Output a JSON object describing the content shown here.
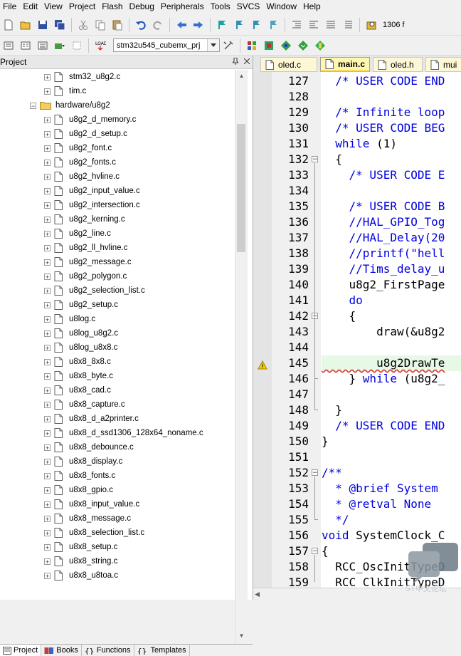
{
  "menu": [
    "File",
    "Edit",
    "View",
    "Project",
    "Flash",
    "Debug",
    "Peripherals",
    "Tools",
    "SVCS",
    "Window",
    "Help"
  ],
  "toolbar": {
    "find_text": "1306 f",
    "target": "stm32u545_cubemx_prj"
  },
  "project_panel": {
    "title": "Project",
    "pin_icon": "pin-icon",
    "close_icon": "close-icon",
    "tree": [
      {
        "label": "stm32_u8g2.c",
        "type": "file",
        "level": 2
      },
      {
        "label": "tim.c",
        "type": "file",
        "level": 2
      },
      {
        "label": "hardware/u8g2",
        "type": "folder",
        "level": 1
      },
      {
        "label": "u8g2_d_memory.c",
        "type": "file",
        "level": 2
      },
      {
        "label": "u8g2_d_setup.c",
        "type": "file",
        "level": 2
      },
      {
        "label": "u8g2_font.c",
        "type": "file",
        "level": 2
      },
      {
        "label": "u8g2_fonts.c",
        "type": "file",
        "level": 2
      },
      {
        "label": "u8g2_hvline.c",
        "type": "file",
        "level": 2
      },
      {
        "label": "u8g2_input_value.c",
        "type": "file",
        "level": 2
      },
      {
        "label": "u8g2_intersection.c",
        "type": "file",
        "level": 2
      },
      {
        "label": "u8g2_kerning.c",
        "type": "file",
        "level": 2
      },
      {
        "label": "u8g2_line.c",
        "type": "file",
        "level": 2
      },
      {
        "label": "u8g2_ll_hvline.c",
        "type": "file",
        "level": 2
      },
      {
        "label": "u8g2_message.c",
        "type": "file",
        "level": 2
      },
      {
        "label": "u8g2_polygon.c",
        "type": "file",
        "level": 2
      },
      {
        "label": "u8g2_selection_list.c",
        "type": "file",
        "level": 2
      },
      {
        "label": "u8g2_setup.c",
        "type": "file",
        "level": 2
      },
      {
        "label": "u8log.c",
        "type": "file",
        "level": 2
      },
      {
        "label": "u8log_u8g2.c",
        "type": "file",
        "level": 2
      },
      {
        "label": "u8log_u8x8.c",
        "type": "file",
        "level": 2
      },
      {
        "label": "u8x8_8x8.c",
        "type": "file",
        "level": 2
      },
      {
        "label": "u8x8_byte.c",
        "type": "file",
        "level": 2
      },
      {
        "label": "u8x8_cad.c",
        "type": "file",
        "level": 2
      },
      {
        "label": "u8x8_capture.c",
        "type": "file",
        "level": 2
      },
      {
        "label": "u8x8_d_a2printer.c",
        "type": "file",
        "level": 2
      },
      {
        "label": "u8x8_d_ssd1306_128x64_noname.c",
        "type": "file",
        "level": 2
      },
      {
        "label": "u8x8_debounce.c",
        "type": "file",
        "level": 2
      },
      {
        "label": "u8x8_display.c",
        "type": "file",
        "level": 2
      },
      {
        "label": "u8x8_fonts.c",
        "type": "file",
        "level": 2
      },
      {
        "label": "u8x8_gpio.c",
        "type": "file",
        "level": 2
      },
      {
        "label": "u8x8_input_value.c",
        "type": "file",
        "level": 2
      },
      {
        "label": "u8x8_message.c",
        "type": "file",
        "level": 2
      },
      {
        "label": "u8x8_selection_list.c",
        "type": "file",
        "level": 2
      },
      {
        "label": "u8x8_setup.c",
        "type": "file",
        "level": 2
      },
      {
        "label": "u8x8_string.c",
        "type": "file",
        "level": 2
      },
      {
        "label": "u8x8_u8toa.c",
        "type": "file",
        "level": 2
      }
    ],
    "bottom_tabs": [
      {
        "label": "Project",
        "icon": "project-icon",
        "active": true
      },
      {
        "label": "Books",
        "icon": "books-icon",
        "active": false
      },
      {
        "label": "Functions",
        "icon": "functions-icon",
        "active": false
      },
      {
        "label": "Templates",
        "icon": "templates-icon",
        "active": false
      }
    ]
  },
  "editor": {
    "tabs": [
      {
        "label": "oled.c",
        "active": false
      },
      {
        "label": "main.c",
        "active": true
      },
      {
        "label": "oled.h",
        "active": false
      },
      {
        "label": "mui",
        "active": false
      }
    ],
    "lines": [
      {
        "n": "127",
        "text": "  /* USER CODE END"
      },
      {
        "n": "128",
        "text": ""
      },
      {
        "n": "129",
        "text": "  /* Infinite loop"
      },
      {
        "n": "130",
        "text": "  /* USER CODE BEG"
      },
      {
        "n": "131",
        "text": "  while (1)"
      },
      {
        "n": "132",
        "text": "  {"
      },
      {
        "n": "133",
        "text": "    /* USER CODE E"
      },
      {
        "n": "134",
        "text": ""
      },
      {
        "n": "135",
        "text": "    /* USER CODE B"
      },
      {
        "n": "136",
        "text": "    //HAL_GPIO_Tog"
      },
      {
        "n": "137",
        "text": "    //HAL_Delay(20"
      },
      {
        "n": "138",
        "text": "    //printf(\"hell"
      },
      {
        "n": "139",
        "text": "    //Tims_delay_u"
      },
      {
        "n": "140",
        "text": "    u8g2_FirstPage"
      },
      {
        "n": "141",
        "text": "    do"
      },
      {
        "n": "142",
        "text": "    {"
      },
      {
        "n": "143",
        "text": "        draw(&u8g2"
      },
      {
        "n": "144",
        "text": ""
      },
      {
        "n": "145",
        "text": "        u8g2DrawTe"
      },
      {
        "n": "146",
        "text": "    } while (u8g2_"
      },
      {
        "n": "147",
        "text": ""
      },
      {
        "n": "148",
        "text": "  }"
      },
      {
        "n": "149",
        "text": "  /* USER CODE END"
      },
      {
        "n": "150",
        "text": "}"
      },
      {
        "n": "151",
        "text": ""
      },
      {
        "n": "152",
        "text": "/**"
      },
      {
        "n": "153",
        "text": "  * @brief System"
      },
      {
        "n": "154",
        "text": "  * @retval None"
      },
      {
        "n": "155",
        "text": "  */"
      },
      {
        "n": "156",
        "text": "void SystemClock_C"
      },
      {
        "n": "157",
        "text": "{"
      },
      {
        "n": "158",
        "text": "  RCC_OscInitTypeD"
      },
      {
        "n": "159",
        "text": "  RCC_ClkInitTypeD"
      }
    ]
  },
  "colors": {
    "comment": "#0000e0",
    "keyword": "#0000e0",
    "highlight": "#e6f8e6",
    "active_tab": "#fff6b0"
  }
}
